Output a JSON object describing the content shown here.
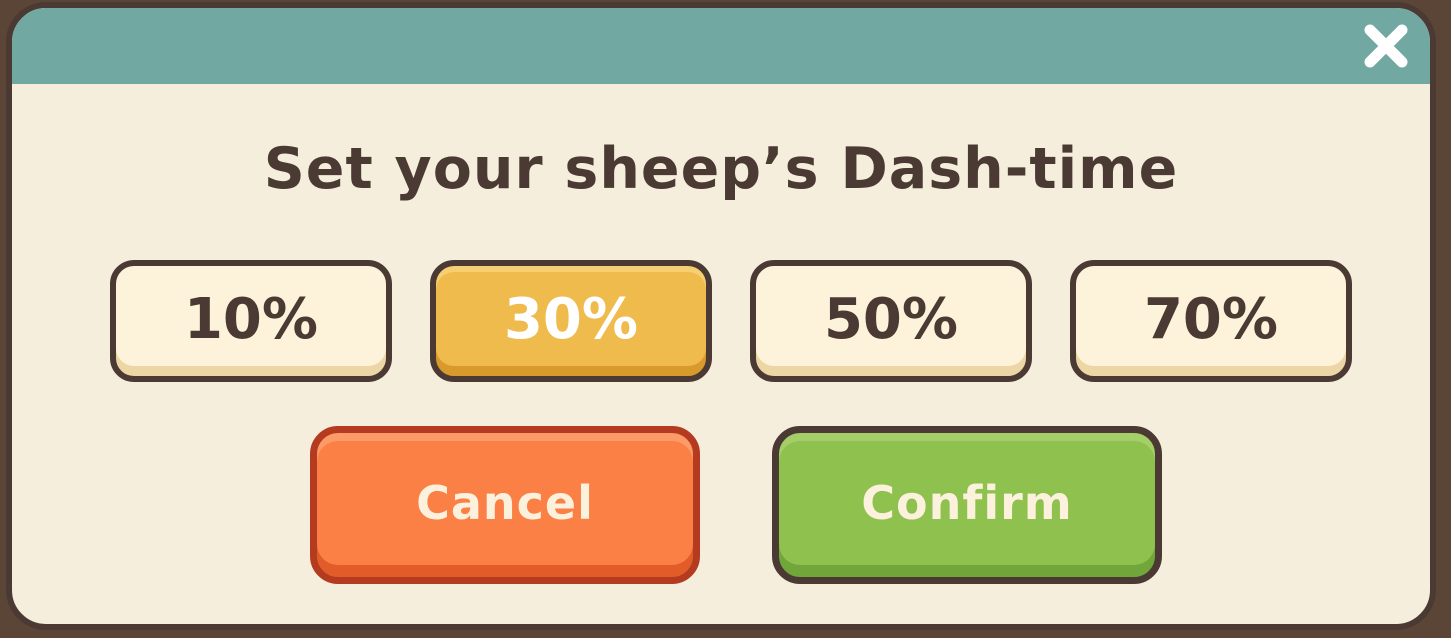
{
  "dialog": {
    "title": "Set your sheep’s Dash-time",
    "close_icon": "close-icon",
    "options": [
      {
        "label": "10%",
        "selected": false
      },
      {
        "label": "30%",
        "selected": true
      },
      {
        "label": "50%",
        "selected": false
      },
      {
        "label": "70%",
        "selected": false
      }
    ],
    "cancel_label": "Cancel",
    "confirm_label": "Confirm"
  },
  "colors": {
    "header": "#72a8a2",
    "panel": "#f5eedc",
    "outline": "#4b3a33",
    "option": "#fdf3da",
    "option_selected": "#efbb4c",
    "cancel": "#fb8045",
    "confirm": "#8fc14e"
  }
}
